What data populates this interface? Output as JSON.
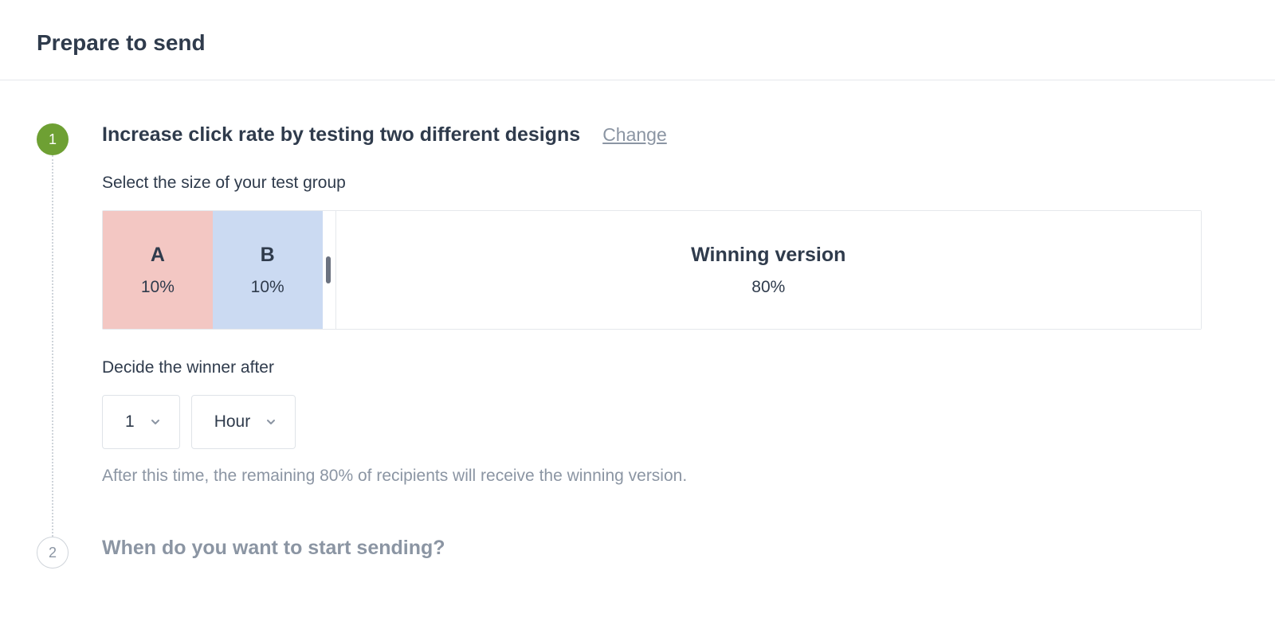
{
  "page": {
    "title": "Prepare to send"
  },
  "step1": {
    "number": "1",
    "title": "Increase click rate by testing two different designs",
    "change": "Change",
    "sizeLabel": "Select the size of your test group",
    "segA": {
      "label": "A",
      "pct": "10%"
    },
    "segB": {
      "label": "B",
      "pct": "10%"
    },
    "winner": {
      "label": "Winning version",
      "pct": "80%"
    },
    "decideLabel": "Decide the winner after",
    "durationValue": "1",
    "durationUnit": "Hour",
    "hint": "After this time, the remaining 80% of recipients will receive the winning version."
  },
  "step2": {
    "number": "2",
    "title": "When do you want to start sending?"
  }
}
